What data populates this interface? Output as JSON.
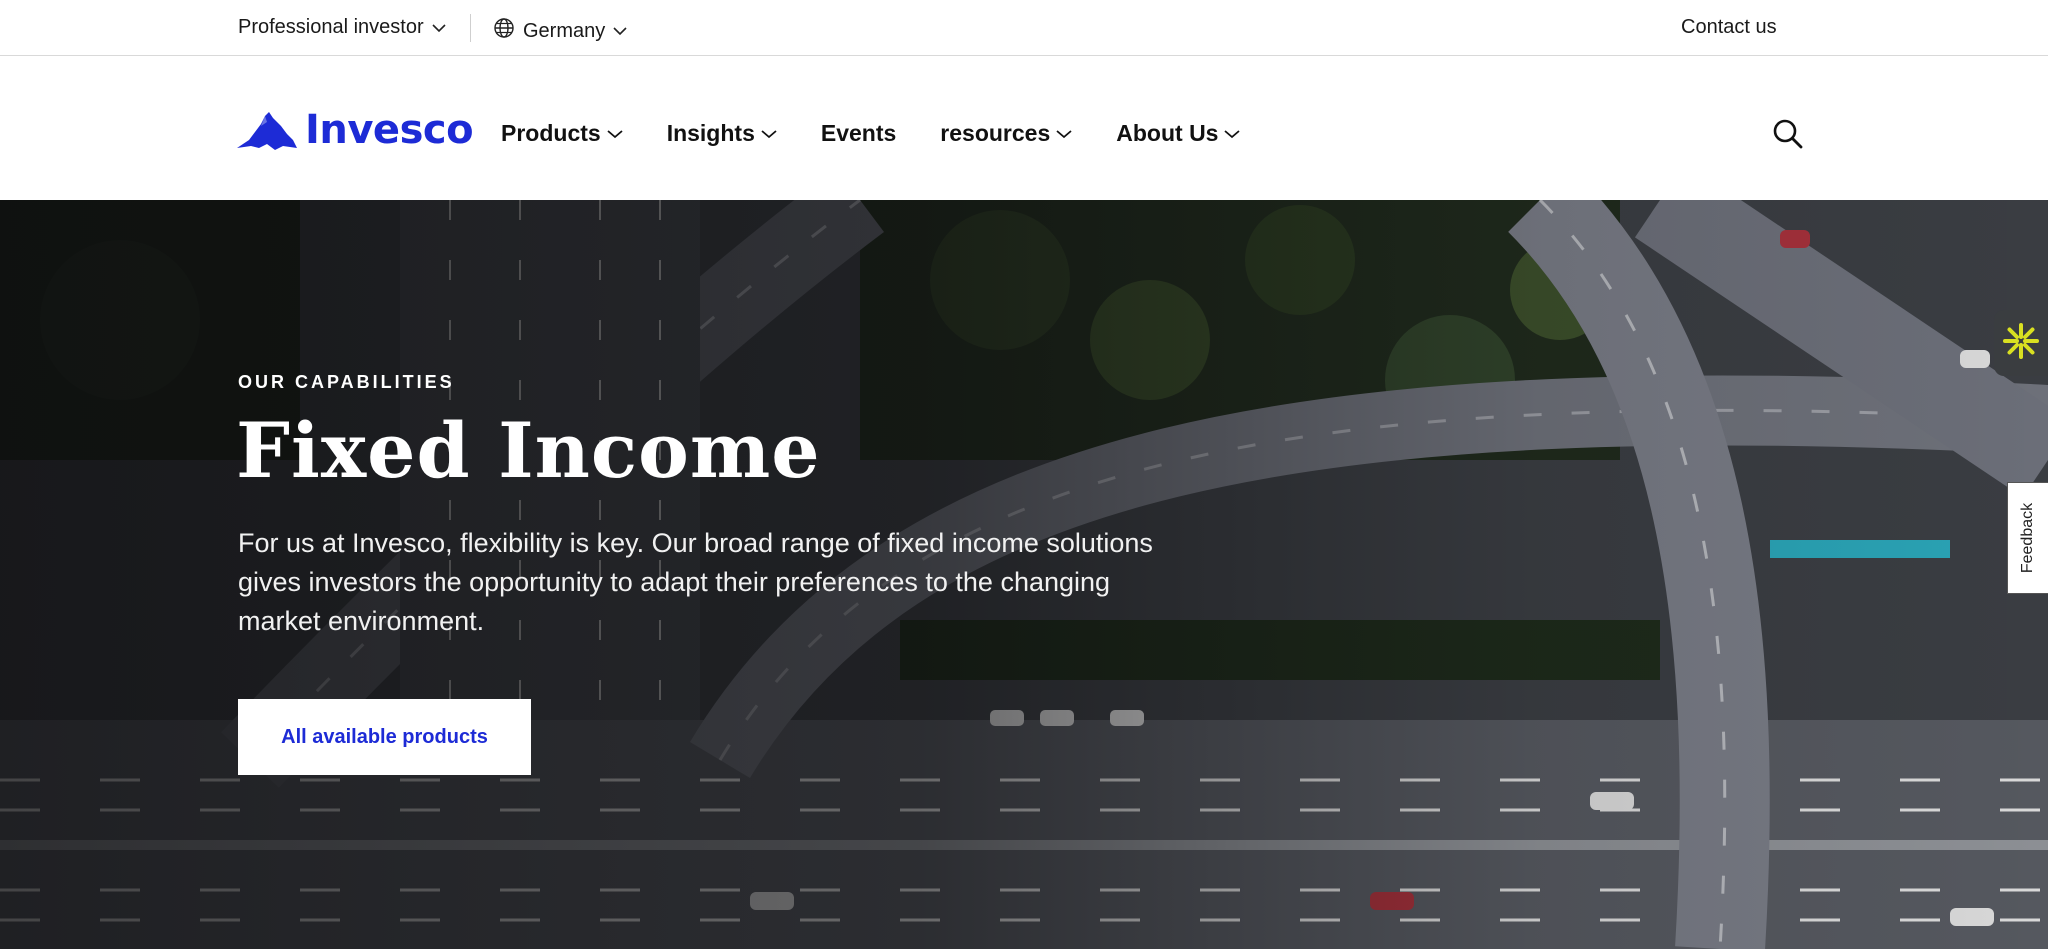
{
  "utility_bar": {
    "investor_type": "Professional investor",
    "country": "Germany",
    "contact": "Contact us"
  },
  "brand": {
    "name": "Invesco",
    "color": "#1d2bd6"
  },
  "nav": {
    "items": [
      {
        "label": "Products",
        "has_dropdown": true
      },
      {
        "label": "Insights",
        "has_dropdown": true
      },
      {
        "label": "Events",
        "has_dropdown": false
      },
      {
        "label": "resources",
        "has_dropdown": true
      },
      {
        "label": "About Us",
        "has_dropdown": true
      }
    ],
    "search_icon": "search-icon"
  },
  "hero": {
    "eyebrow": "OUR CAPABILITIES",
    "title": "Fixed Income",
    "description": "For us at Invesco, flexibility is key. Our broad range of fixed income solutions gives investors the opportunity to adapt their preferences to the changing market environment.",
    "cta_label": "All available products"
  },
  "widgets": {
    "chat_icon": "asterisk-chat-icon",
    "feedback_label": "Feedback"
  }
}
